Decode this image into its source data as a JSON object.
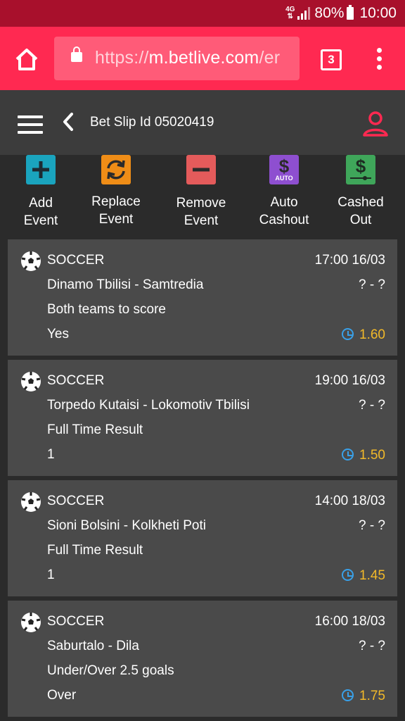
{
  "status_bar": {
    "network": "4G",
    "battery": "80%",
    "time": "10:00"
  },
  "browser": {
    "url_scheme": "https://",
    "url_host": "m.betlive.com",
    "url_path": "/er",
    "tab_count": "3"
  },
  "header": {
    "title": "Bet Slip Id 05020419"
  },
  "actions": [
    {
      "label_line1": "Add",
      "label_line2": "Event",
      "icon": "plus-icon",
      "color": "#1aa4be"
    },
    {
      "label_line1": "Replace",
      "label_line2": "Event",
      "icon": "refresh-icon",
      "color": "#ef8d17"
    },
    {
      "label_line1": "Remove",
      "label_line2": "Event",
      "icon": "minus-icon",
      "color": "#e45b5b"
    },
    {
      "label_line1": "Auto",
      "label_line2": "Cashout",
      "icon": "dollar-auto-icon",
      "badge": "AUTO",
      "color": "#8e4fd0"
    },
    {
      "label_line1": "Cashed",
      "label_line2": "Out",
      "icon": "dollar-slider-icon",
      "color": "#3fa65a"
    }
  ],
  "bets": [
    {
      "sport": "SOCCER",
      "datetime": "17:00 16/03",
      "match": "Dinamo Tbilisi - Samtredia",
      "score": "? - ?",
      "market": "Both teams to score",
      "selection": "Yes",
      "odds": "1.60"
    },
    {
      "sport": "SOCCER",
      "datetime": "19:00 16/03",
      "match": "Torpedo Kutaisi - Lokomotiv Tbilisi",
      "score": "? - ?",
      "market": "Full Time Result",
      "selection": "1",
      "odds": "1.50"
    },
    {
      "sport": "SOCCER",
      "datetime": "14:00 18/03",
      "match": "Sioni Bolsini - Kolkheti Poti",
      "score": "? - ?",
      "market": "Full Time Result",
      "selection": "1",
      "odds": "1.45"
    },
    {
      "sport": "SOCCER",
      "datetime": "16:00 18/03",
      "match": "Saburtalo - Dila",
      "score": "? - ?",
      "market": "Under/Over 2.5 goals",
      "selection": "Over",
      "odds": "1.75"
    }
  ],
  "colors": {
    "status_bar": "#a8102c",
    "browser_bar": "#ff2951",
    "app_header": "#3c3c3c",
    "card": "#4a4a4a",
    "odds": "#f2b929",
    "clock": "#39a0e8"
  }
}
